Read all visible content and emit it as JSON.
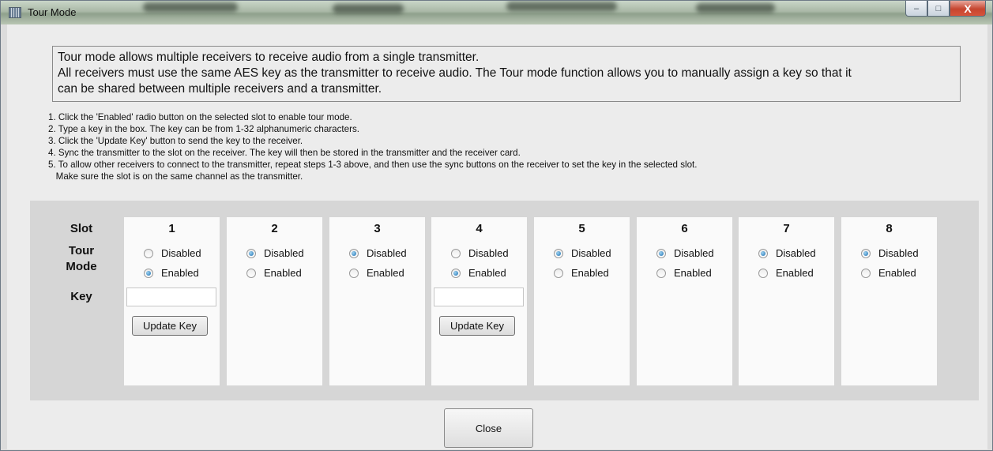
{
  "window": {
    "title": "Tour Mode",
    "icon": "app-grid-icon"
  },
  "caption_buttons": {
    "minimize": "–",
    "maximize": "□",
    "close": "X"
  },
  "description": [
    "Tour mode allows multiple receivers to receive audio from a single transmitter.",
    "All receivers must use the same AES key as the transmitter to receive audio. The Tour mode function allows you to manually assign a key so that it",
    "can be shared between multiple receivers and a transmitter."
  ],
  "steps": [
    "1. Click the 'Enabled' radio button on the selected slot to enable tour mode.",
    "2. Type a key in the box. The key can be from 1-32 alphanumeric characters.",
    "3. Click the 'Update Key' button to send the key to the receiver.",
    "4. Sync the transmitter to the slot on the receiver. The key will then be stored in the transmitter and the receiver card.",
    "5. To allow other receivers to connect to the transmitter, repeat steps 1-3 above, and then use the sync buttons on the receiver to set the key in the selected slot.",
    "   Make sure the slot is on the same channel as the transmitter."
  ],
  "row_labels": {
    "slot": "Slot",
    "tour": "Tour",
    "mode": "Mode",
    "key": "Key"
  },
  "radio_labels": {
    "disabled": "Disabled",
    "enabled": "Enabled"
  },
  "update_key_label": "Update Key",
  "slots": [
    {
      "number": "1",
      "selected": "enabled",
      "key_value": ""
    },
    {
      "number": "2",
      "selected": "disabled"
    },
    {
      "number": "3",
      "selected": "disabled"
    },
    {
      "number": "4",
      "selected": "enabled",
      "key_value": ""
    },
    {
      "number": "5",
      "selected": "disabled"
    },
    {
      "number": "6",
      "selected": "disabled"
    },
    {
      "number": "7",
      "selected": "disabled"
    },
    {
      "number": "8",
      "selected": "disabled"
    }
  ],
  "close_label": "Close",
  "colors": {
    "radio_selected": "#1b6fb0",
    "close_caption": "#c6452f"
  }
}
